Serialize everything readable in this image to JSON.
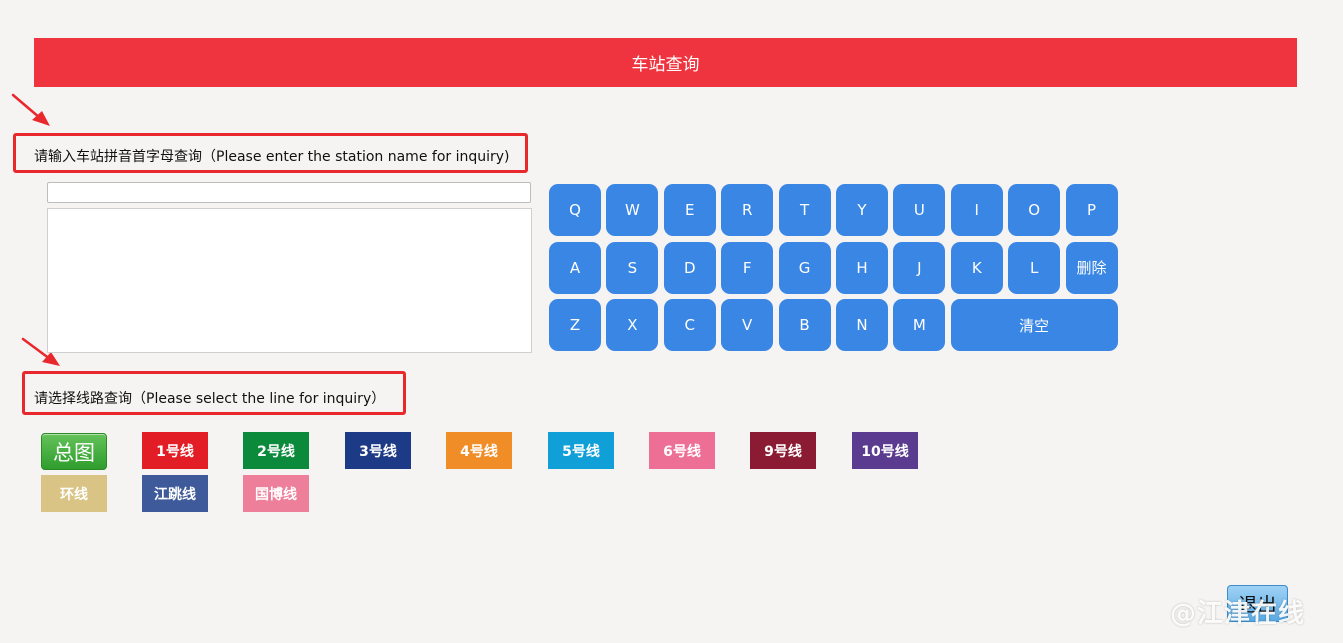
{
  "header": {
    "title": "车站查询"
  },
  "input_section": {
    "label": "请输入车站拼音首字母查询（Please enter the station name for inquiry)",
    "search_value": "",
    "search_placeholder": ""
  },
  "keyboard": {
    "rows": [
      [
        "Q",
        "W",
        "E",
        "R",
        "T",
        "Y",
        "U",
        "I",
        "O",
        "P"
      ],
      [
        "A",
        "S",
        "D",
        "F",
        "G",
        "H",
        "J",
        "K",
        "L",
        "删除"
      ],
      [
        "Z",
        "X",
        "C",
        "V",
        "B",
        "N",
        "M",
        "清空"
      ]
    ]
  },
  "line_section": {
    "label": "请选择线路查询（Please select the line for inquiry）",
    "lines": [
      {
        "id": "overview",
        "label": "总图",
        "color": "#3aa636"
      },
      {
        "id": "line-1",
        "label": "1号线",
        "color": "#e21d25"
      },
      {
        "id": "line-2",
        "label": "2号线",
        "color": "#0b8a3c"
      },
      {
        "id": "line-3",
        "label": "3号线",
        "color": "#1d3a86"
      },
      {
        "id": "line-4",
        "label": "4号线",
        "color": "#f08d26"
      },
      {
        "id": "line-5",
        "label": "5号线",
        "color": "#119fd8"
      },
      {
        "id": "line-6",
        "label": "6号线",
        "color": "#ee6f95"
      },
      {
        "id": "line-9",
        "label": "9号线",
        "color": "#8b1b32"
      },
      {
        "id": "line-10",
        "label": "10号线",
        "color": "#5a3b8f"
      },
      {
        "id": "loop",
        "label": "环线",
        "color": "#d9c485"
      },
      {
        "id": "jiangtiao",
        "label": "江跳线",
        "color": "#3f5a9a"
      },
      {
        "id": "guobo",
        "label": "国博线",
        "color": "#ee7f9a"
      }
    ]
  },
  "footer": {
    "exit_label": "退出",
    "watermark": "@江津在线"
  }
}
